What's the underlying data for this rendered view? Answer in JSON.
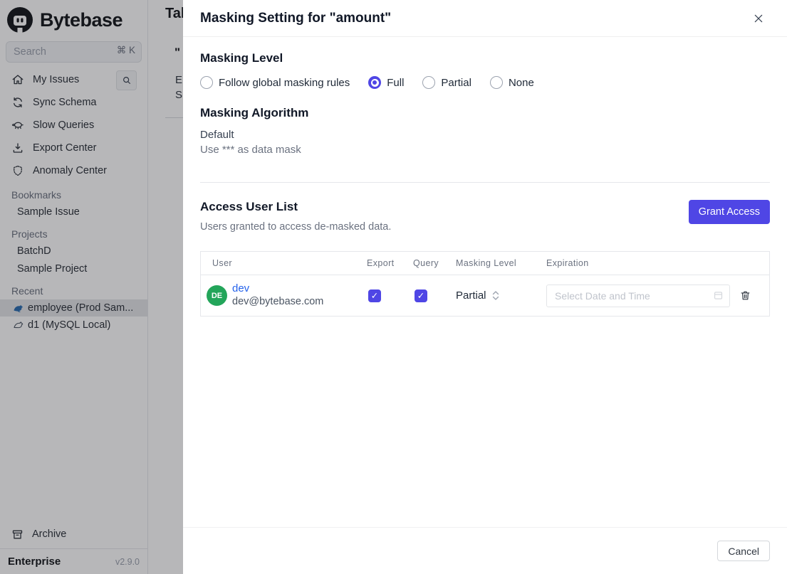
{
  "sidebar": {
    "logo_text": "Bytebase",
    "search": {
      "placeholder": "Search",
      "shortcut": "⌘ K"
    },
    "nav": [
      {
        "label": "My Issues",
        "icon": "home-icon"
      },
      {
        "label": "Sync Schema",
        "icon": "sync-icon"
      },
      {
        "label": "Slow Queries",
        "icon": "turtle-icon"
      },
      {
        "label": "Export Center",
        "icon": "download-icon"
      },
      {
        "label": "Anomaly Center",
        "icon": "shield-icon"
      }
    ],
    "sections": [
      {
        "label": "Bookmarks",
        "items": [
          {
            "label": "Sample Issue"
          }
        ]
      },
      {
        "label": "Projects",
        "items": [
          {
            "label": "BatchD"
          },
          {
            "label": "Sample Project"
          }
        ]
      },
      {
        "label": "Recent",
        "items": [
          {
            "label": "employee (Prod Sam...",
            "icon": "mysql-icon",
            "active": true
          },
          {
            "label": "d1 (MySQL Local)",
            "icon": "mysql-outline-icon",
            "active": false
          }
        ]
      }
    ],
    "footer": {
      "archive_label": "Archive",
      "plan": "Enterprise",
      "version": "v2.9.0"
    }
  },
  "background_page": {
    "clipped_title": "Tab",
    "fragment_quote": "\"",
    "fragment_e": "E",
    "fragment_s": "S"
  },
  "modal": {
    "title": "Masking Setting for \"amount\"",
    "colors": {
      "accent": "#4f46e5",
      "link": "#2563eb"
    },
    "masking_level": {
      "heading": "Masking Level",
      "options": [
        {
          "label": "Follow global masking rules",
          "selected": false
        },
        {
          "label": "Full",
          "selected": true
        },
        {
          "label": "Partial",
          "selected": false
        },
        {
          "label": "None",
          "selected": false
        }
      ]
    },
    "masking_algorithm": {
      "heading": "Masking Algorithm",
      "name": "Default",
      "description": "Use *** as data mask"
    },
    "access_user_list": {
      "heading": "Access User List",
      "subtitle": "Users granted to access de-masked data.",
      "grant_button": "Grant Access",
      "table": {
        "headers": [
          "User",
          "Export",
          "Query",
          "Masking Level",
          "Expiration"
        ],
        "rows": [
          {
            "avatar_initials": "DE",
            "avatar_color": "#23a55a",
            "name": "dev",
            "email": "dev@bytebase.com",
            "export_checked": true,
            "query_checked": true,
            "masking_level": "Partial",
            "expiration_value": "",
            "expiration_placeholder": "Select Date and Time"
          }
        ]
      }
    },
    "footer": {
      "cancel_label": "Cancel"
    }
  }
}
